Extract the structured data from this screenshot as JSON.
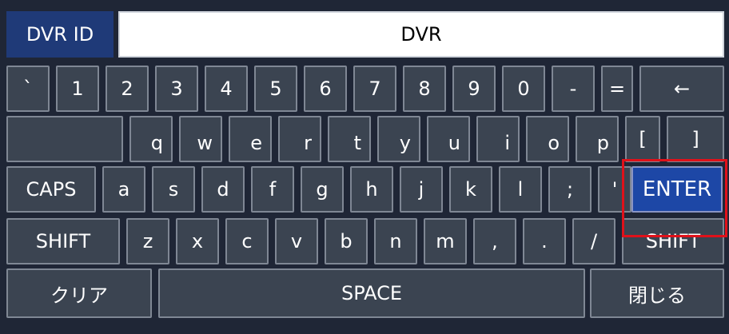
{
  "header": {
    "label": "DVR ID",
    "value": "DVR"
  },
  "rows": {
    "row1": [
      "`",
      "1",
      "2",
      "3",
      "4",
      "5",
      "6",
      "7",
      "8",
      "9",
      "0",
      "-",
      "=",
      "←"
    ],
    "row2": [
      "",
      "q",
      "w",
      "e",
      "r",
      "t",
      "y",
      "u",
      "i",
      "o",
      "p",
      "[",
      "]",
      ""
    ],
    "row3": [
      "CAPS",
      "a",
      "s",
      "d",
      "f",
      "g",
      "h",
      "j",
      "k",
      "l",
      ";",
      "'",
      "ENTER"
    ],
    "row4": [
      "SHIFT",
      "z",
      "x",
      "c",
      "v",
      "b",
      "n",
      "m",
      ",",
      ".",
      "/",
      "SHIFT"
    ],
    "row5": [
      "クリア",
      "SPACE",
      "閉じる"
    ]
  },
  "colors": {
    "background": "#1f2636",
    "key": "#3b4451",
    "enter": "#1d47a6",
    "label_box": "#1f3a78",
    "highlight": "#e0111a"
  }
}
